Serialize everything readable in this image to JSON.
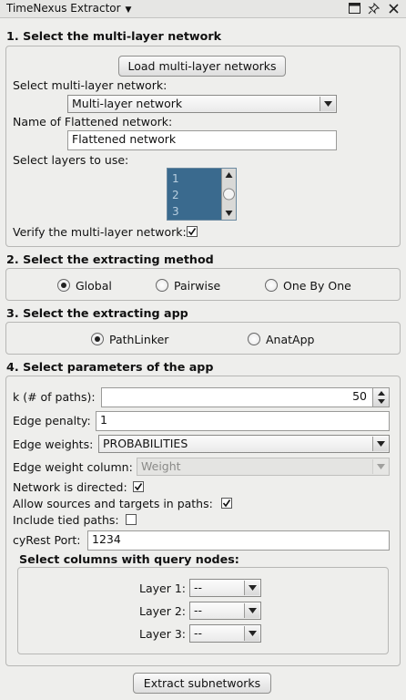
{
  "window": {
    "title": "TimeNexus Extractor"
  },
  "section1": {
    "title": "1. Select the multi-layer network",
    "load_button": "Load multi-layer networks",
    "select_label": "Select multi-layer network:",
    "select_value": "Multi-layer network",
    "name_label": "Name of Flattened network:",
    "name_value": "Flattened network",
    "layers_label": "Select layers to use:",
    "layers": [
      "1",
      "2",
      "3"
    ],
    "verify_label": "Verify the multi-layer network:",
    "verify_checked": true
  },
  "section2": {
    "title": "2. Select the extracting method",
    "options": [
      "Global",
      "Pairwise",
      "One By One"
    ],
    "selected": "Global"
  },
  "section3": {
    "title": "3. Select the extracting app",
    "options": [
      "PathLinker",
      "AnatApp"
    ],
    "selected": "PathLinker"
  },
  "section4": {
    "title": "4. Select parameters of the app",
    "k_label": "k (# of paths):",
    "k_value": "50",
    "edge_penalty_label": "Edge penalty:",
    "edge_penalty_value": "1",
    "edge_weights_label": "Edge weights:",
    "edge_weights_value": "PROBABILITIES",
    "edge_weight_column_label": "Edge weight column:",
    "edge_weight_column_value": "Weight",
    "directed_label": "Network is directed:",
    "directed_checked": true,
    "allow_label": "Allow sources and targets in paths:",
    "allow_checked": true,
    "tied_label": "Include tied paths:",
    "tied_checked": false,
    "port_label": "cyRest Port:",
    "port_value": "1234",
    "query_title": "Select columns with query nodes:",
    "query_layers": [
      {
        "label": "Layer 1:",
        "value": "--"
      },
      {
        "label": "Layer 2:",
        "value": "--"
      },
      {
        "label": "Layer 3:",
        "value": "--"
      }
    ]
  },
  "extract_button": "Extract subnetworks"
}
